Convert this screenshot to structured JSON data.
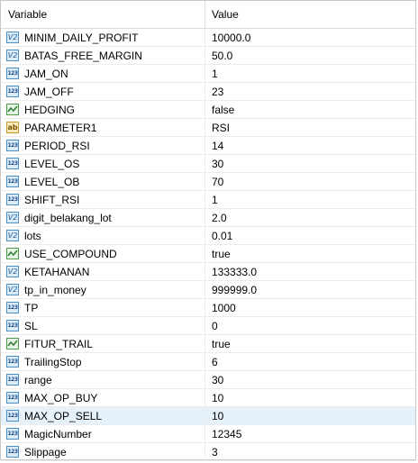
{
  "header": {
    "variable_label": "Variable",
    "value_label": "Value"
  },
  "rows": [
    {
      "name": "MINIM_DAILY_PROFIT",
      "value": "10000.0",
      "icon": "double-icon"
    },
    {
      "name": "BATAS_FREE_MARGIN",
      "value": "50.0",
      "icon": "double-icon"
    },
    {
      "name": "JAM_ON",
      "value": "1",
      "icon": "integer-icon"
    },
    {
      "name": "JAM_OFF",
      "value": "23",
      "icon": "integer-icon"
    },
    {
      "name": "HEDGING",
      "value": "false",
      "icon": "boolean-icon"
    },
    {
      "name": "PARAMETER1",
      "value": "RSI",
      "icon": "string-icon"
    },
    {
      "name": "PERIOD_RSI",
      "value": "14",
      "icon": "integer-icon"
    },
    {
      "name": "LEVEL_OS",
      "value": "30",
      "icon": "integer-icon"
    },
    {
      "name": "LEVEL_OB",
      "value": "70",
      "icon": "integer-icon"
    },
    {
      "name": "SHIFT_RSI",
      "value": "1",
      "icon": "integer-icon"
    },
    {
      "name": "digit_belakang_lot",
      "value": "2.0",
      "icon": "double-icon"
    },
    {
      "name": "lots",
      "value": "0.01",
      "icon": "double-icon"
    },
    {
      "name": "USE_COMPOUND",
      "value": "true",
      "icon": "boolean-icon"
    },
    {
      "name": "KETAHANAN",
      "value": "133333.0",
      "icon": "double-icon"
    },
    {
      "name": "tp_in_money",
      "value": "999999.0",
      "icon": "double-icon"
    },
    {
      "name": "TP",
      "value": "1000",
      "icon": "integer-icon"
    },
    {
      "name": "SL",
      "value": "0",
      "icon": "integer-icon"
    },
    {
      "name": "FITUR_TRAIL",
      "value": "true",
      "icon": "boolean-icon"
    },
    {
      "name": "TrailingStop",
      "value": "6",
      "icon": "integer-icon"
    },
    {
      "name": "range",
      "value": "30",
      "icon": "integer-icon"
    },
    {
      "name": "MAX_OP_BUY",
      "value": "10",
      "icon": "integer-icon"
    },
    {
      "name": "MAX_OP_SELL",
      "value": "10",
      "icon": "integer-icon",
      "selected": true
    },
    {
      "name": "MagicNumber",
      "value": "12345",
      "icon": "integer-icon"
    },
    {
      "name": "Slippage",
      "value": "3",
      "icon": "integer-icon"
    }
  ],
  "icons": {
    "double-icon": "V2",
    "integer-icon": "123",
    "string-icon": "ab"
  },
  "colors": {
    "selected_row": "#e5f1fb",
    "grid_line": "#ececec",
    "double_icon": "#4f8fc8",
    "string_icon": "#c99a2e",
    "boolean_icon": "#4b9a4b"
  }
}
